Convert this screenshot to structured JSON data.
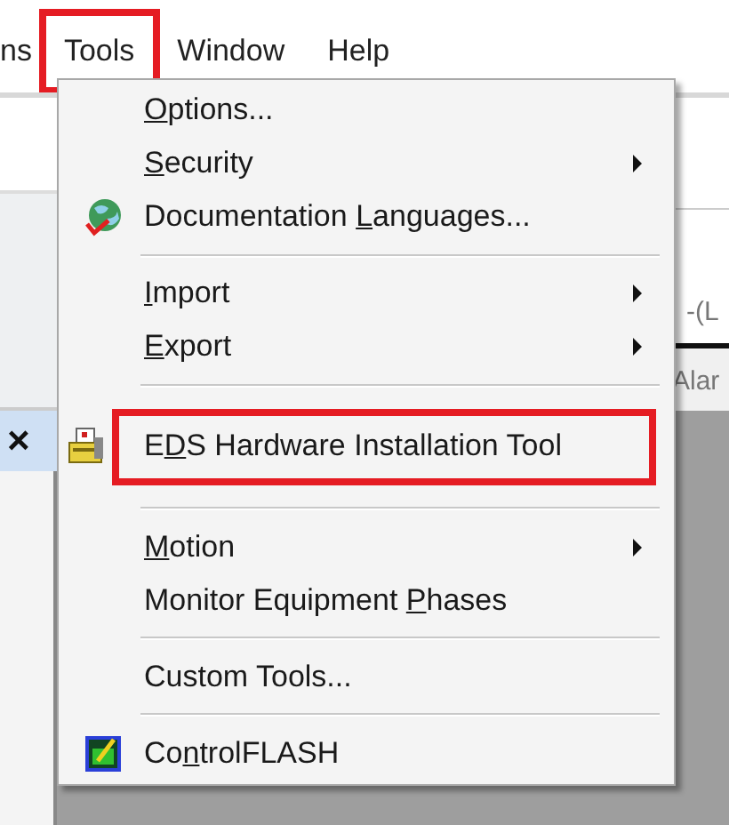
{
  "menubar": {
    "items": [
      {
        "label": "ns",
        "highlighted": false
      },
      {
        "label": "Tools",
        "highlighted": true
      },
      {
        "label": "Window",
        "highlighted": false
      },
      {
        "label": "Help",
        "highlighted": false
      }
    ]
  },
  "background": {
    "close_glyph": "×",
    "rung_text": "-(L",
    "tab_text": "Alar"
  },
  "tools_menu": {
    "items": [
      {
        "kind": "item",
        "key": "O",
        "post": "ptions...",
        "submenu": false,
        "highlighted": false
      },
      {
        "kind": "item",
        "key": "S",
        "post": "ecurity",
        "submenu": true,
        "highlighted": false
      },
      {
        "kind": "item",
        "pre": "Documentation ",
        "key": "L",
        "post": "anguages...",
        "submenu": false,
        "highlighted": false
      },
      {
        "kind": "separator"
      },
      {
        "kind": "item",
        "key": "I",
        "post": "mport",
        "submenu": true,
        "highlighted": false
      },
      {
        "kind": "item",
        "key": "E",
        "post": "xport",
        "submenu": true,
        "highlighted": false
      },
      {
        "kind": "separator"
      },
      {
        "kind": "item",
        "pre": "E",
        "key": "D",
        "post": "S Hardware Installation Tool",
        "submenu": false,
        "highlighted": true
      },
      {
        "kind": "separator"
      },
      {
        "kind": "item",
        "key": "M",
        "post": "otion",
        "submenu": true,
        "highlighted": false
      },
      {
        "kind": "item",
        "pre": "Monitor Equipment ",
        "key": "P",
        "post": "hases",
        "submenu": false,
        "highlighted": false
      },
      {
        "kind": "separator"
      },
      {
        "kind": "item",
        "label": "Custom Tools...",
        "submenu": false,
        "highlighted": false
      },
      {
        "kind": "separator"
      },
      {
        "kind": "item",
        "pre": "Co",
        "key": "n",
        "post": "trolFLASH",
        "submenu": false,
        "highlighted": false
      }
    ]
  }
}
